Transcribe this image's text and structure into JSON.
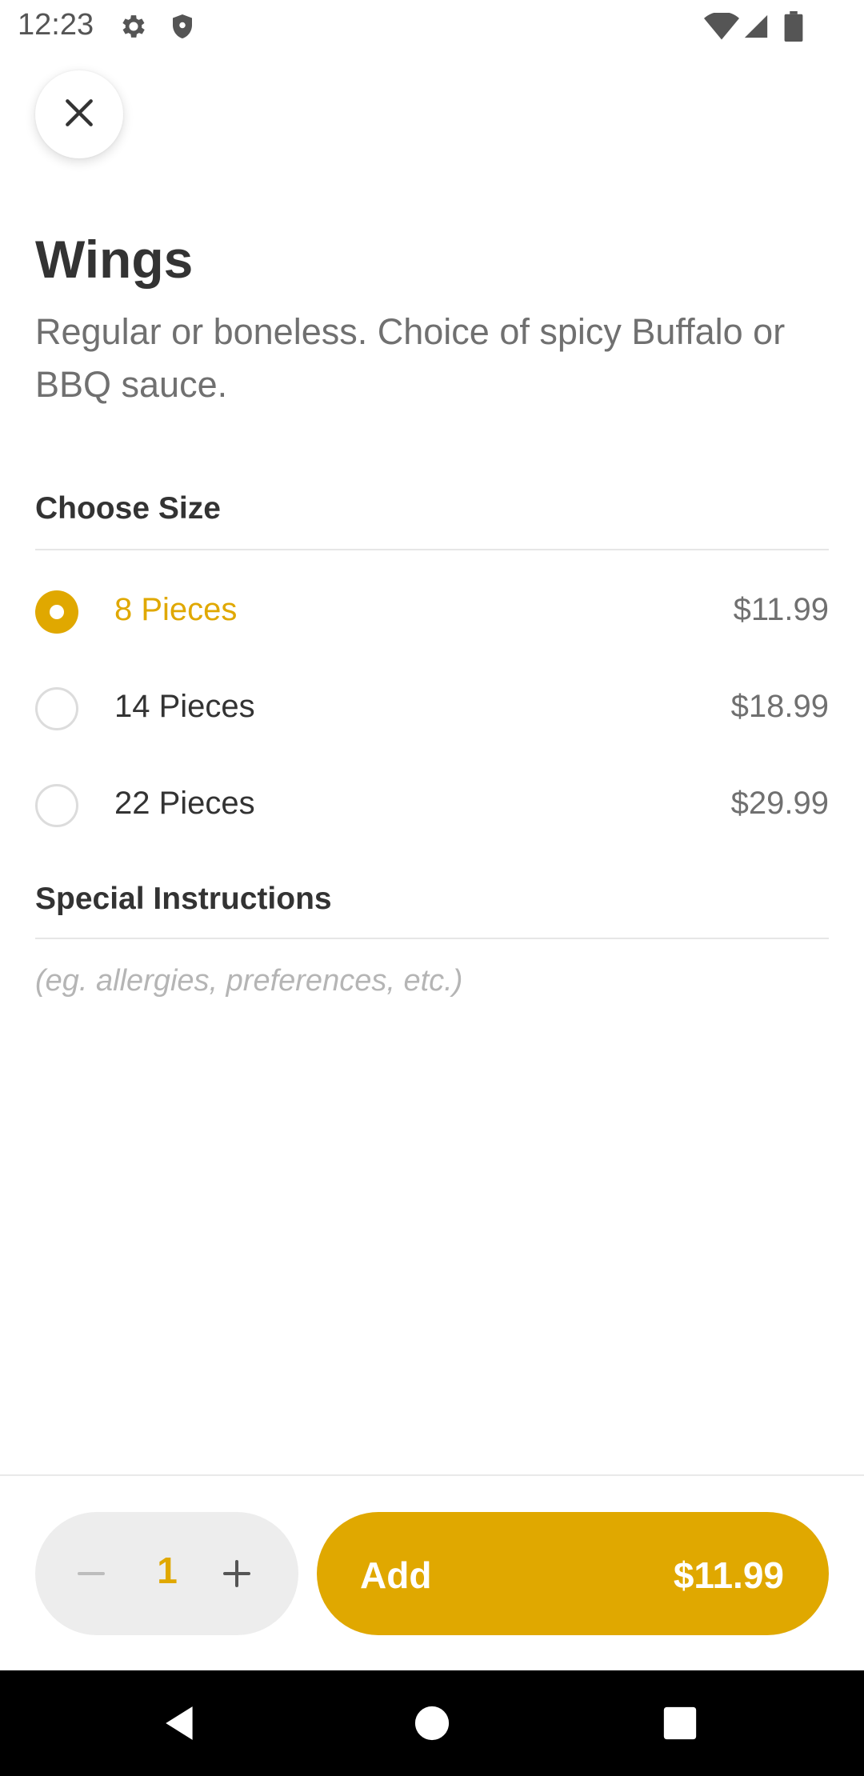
{
  "status_bar": {
    "time": "12:23",
    "left_icons": [
      "gear-icon",
      "shield-icon"
    ],
    "right_icons": [
      "wifi-icon",
      "signal-icon",
      "battery-icon"
    ]
  },
  "header": {
    "close_icon": "close-icon"
  },
  "item": {
    "title": "Wings",
    "description": "Regular or boneless. Choice of spicy Buffalo or BBQ sauce."
  },
  "size_section": {
    "title": "Choose Size",
    "options": [
      {
        "label": "8 Pieces",
        "price": "$11.99",
        "selected": true
      },
      {
        "label": "14 Pieces",
        "price": "$18.99",
        "selected": false
      },
      {
        "label": "22 Pieces",
        "price": "$29.99",
        "selected": false
      }
    ]
  },
  "instructions_section": {
    "title": "Special Instructions",
    "placeholder": "(eg. allergies, preferences, etc.)",
    "value": ""
  },
  "footer": {
    "quantity": "1",
    "add_label": "Add",
    "add_price": "$11.99"
  },
  "colors": {
    "accent": "#e0a800",
    "text_primary": "#333333",
    "text_secondary": "#707070",
    "stepper_bg": "#ededed"
  },
  "nav_bar": {
    "icons": [
      "back-icon",
      "home-icon",
      "recents-icon"
    ]
  }
}
